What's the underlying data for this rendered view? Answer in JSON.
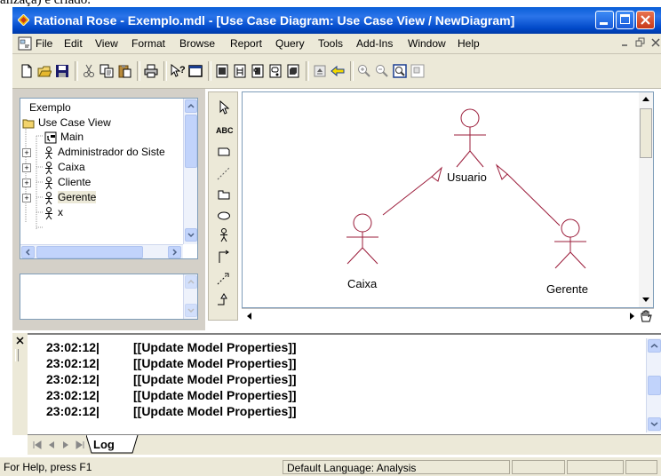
{
  "cutoff_text": "alizaçã) e criado.",
  "window": {
    "title": "Rational Rose - Exemplo.mdl - [Use Case Diagram: Use Case View / NewDiagram]"
  },
  "menu": {
    "items": [
      "File",
      "Edit",
      "View",
      "Format",
      "Browse",
      "Report",
      "Query",
      "Tools",
      "Add-Ins",
      "Window",
      "Help"
    ]
  },
  "toolbar": {
    "icons": [
      "new-icon",
      "open-icon",
      "save-icon",
      "cut-icon",
      "copy-icon",
      "paste-icon",
      "print-icon",
      "context-help-icon",
      "view-doc-icon",
      "browse-class-diagram-icon",
      "browse-interaction-diagram-icon",
      "browse-component-diagram-icon",
      "browse-state-diagram-icon",
      "browse-deployment-diagram-icon",
      "browse-parent-icon",
      "browse-previous-icon",
      "zoom-in-icon",
      "zoom-out-icon",
      "fit-in-window-icon",
      "undo-fit-icon"
    ]
  },
  "browser": {
    "items": [
      {
        "label": "Exemplo",
        "icon": "model-icon"
      },
      {
        "label": "Use Case View",
        "icon": "folder-icon"
      },
      {
        "label": "Main",
        "icon": "diagram-icon"
      },
      {
        "label": "Administrador do Siste",
        "icon": "actor-icon"
      },
      {
        "label": "Caixa",
        "icon": "actor-icon"
      },
      {
        "label": "Cliente",
        "icon": "actor-icon"
      },
      {
        "label": "Gerente",
        "icon": "actor-icon"
      },
      {
        "label": "x",
        "icon": "actor-icon"
      }
    ]
  },
  "palette": {
    "tools": [
      "selection-tool-icon",
      "text-tool-icon",
      "note-tool-icon",
      "anchor-note-icon",
      "package-tool-icon",
      "use-case-tool-icon",
      "actor-tool-icon",
      "unidirectional-association-icon",
      "dependency-tool-icon",
      "generalization-tool-icon"
    ],
    "text_label": "ABC"
  },
  "diagram": {
    "actors": {
      "usuario": "Usuario",
      "caixa": "Caixa",
      "gerente": "Gerente"
    }
  },
  "log": {
    "entries": [
      {
        "time": "23:02:12|",
        "message": "[[Update Model Properties]]"
      },
      {
        "time": "23:02:12|",
        "message": "[[Update Model Properties]]"
      },
      {
        "time": "23:02:12|",
        "message": "[[Update Model Properties]]"
      },
      {
        "time": "23:02:12|",
        "message": "[[Update Model Properties]]"
      },
      {
        "time": "23:02:12|",
        "message": "[[Update Model Properties]]"
      }
    ],
    "tab": "Log"
  },
  "status": {
    "help": "For Help, press F1",
    "language": "Default Language: Analysis"
  },
  "colors": {
    "title_blue": "#0a5fd8",
    "actor_stroke": "#9b1c3a",
    "chrome": "#ece9d8"
  }
}
